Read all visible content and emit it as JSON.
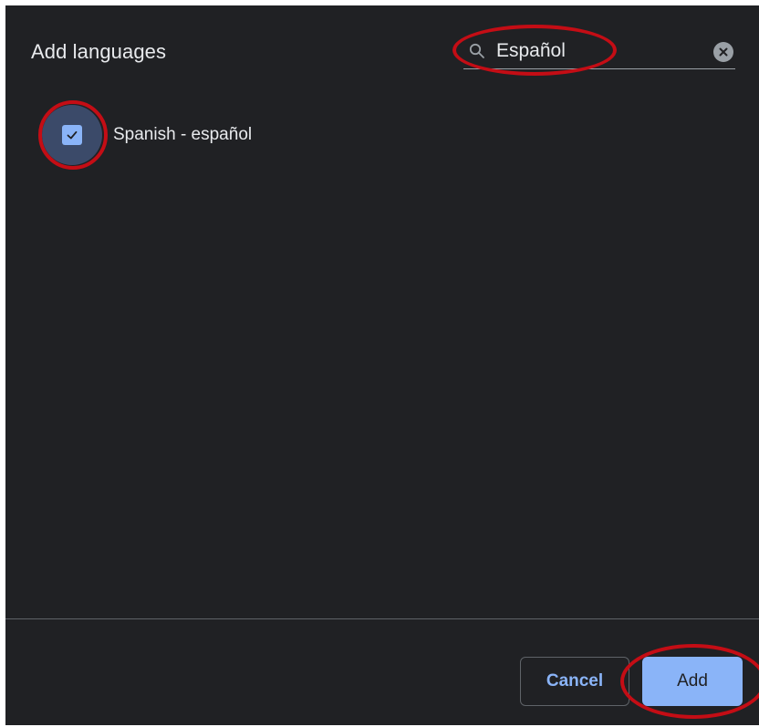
{
  "dialog": {
    "title": "Add languages"
  },
  "search": {
    "value": "Español",
    "icon": "search-icon",
    "clear_icon": "clear-icon"
  },
  "languages": [
    {
      "label": "Spanish - español",
      "checked": true
    }
  ],
  "footer": {
    "cancel_label": "Cancel",
    "add_label": "Add"
  },
  "colors": {
    "background": "#202124",
    "accent": "#8ab4f8",
    "text": "#e8eaed",
    "annotation": "#c40d15"
  }
}
